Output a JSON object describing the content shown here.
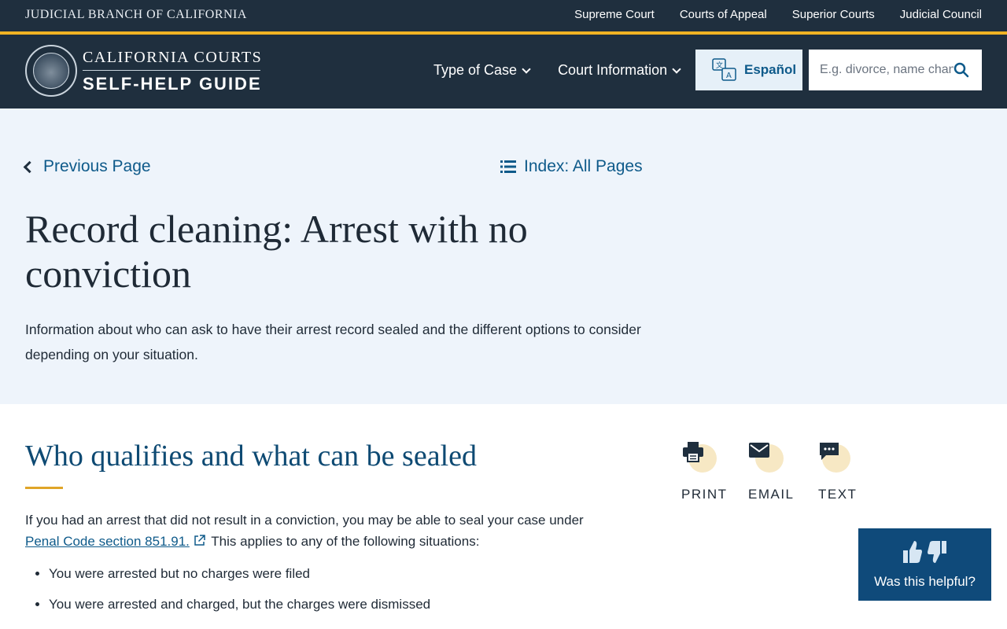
{
  "topbar": {
    "title": "JUDICIAL BRANCH OF CALIFORNIA",
    "links": [
      "Supreme Court",
      "Courts of Appeal",
      "Superior Courts",
      "Judicial Council"
    ]
  },
  "header": {
    "brand_top": "CALIFORNIA COURTS",
    "brand_bottom": "SELF-HELP GUIDE",
    "nav": [
      "Type of Case",
      "Court Information"
    ],
    "language_button": "Español",
    "search_placeholder": "E.g. divorce, name change, ..."
  },
  "hero": {
    "previous_page": "Previous Page",
    "index_link": "Index: All Pages",
    "title": "Record cleaning: Arrest with no conviction",
    "intro": "Information about who can ask to have their arrest record sealed and the different options to consider depending on your situation."
  },
  "content": {
    "section_title": "Who qualifies and what can be sealed",
    "para_before": "If you had an arrest that did not result in a conviction, you may be able to seal your case under ",
    "para_link": "Penal Code section 851.91.",
    "para_after": " This applies to any of the following situations:",
    "bullets": [
      "You were arrested but no charges were filed",
      "You were arrested and charged, but the charges were dismissed"
    ]
  },
  "share": {
    "print": "PRINT",
    "email": "EMAIL",
    "text": "TEXT"
  },
  "feedback": {
    "label": "Was this helpful?"
  },
  "colors": {
    "navy": "#1f2f3e",
    "gold": "#f0b323",
    "link": "#0e5a8a",
    "hero_bg": "#eef4fb",
    "feedback_bg": "#0f4a7a"
  },
  "icons": [
    "seal-logo",
    "chevron-down-icon",
    "translate-icon",
    "search-icon",
    "chevron-left-icon",
    "list-icon",
    "external-link-icon",
    "printer-icon",
    "envelope-icon",
    "chat-icon",
    "thumbs-up-icon",
    "thumbs-down-icon"
  ]
}
